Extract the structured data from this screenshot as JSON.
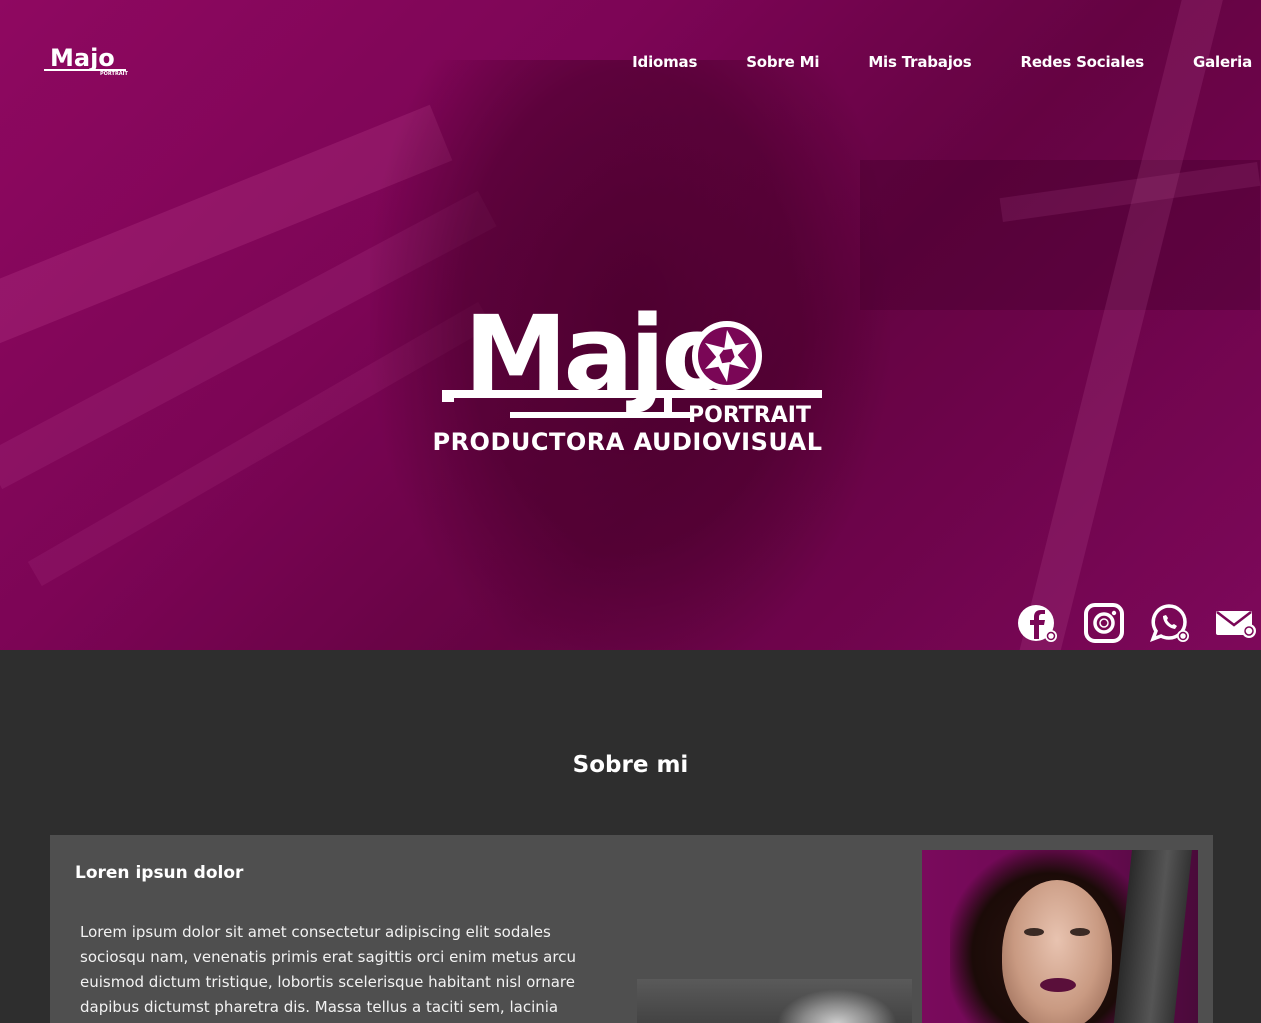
{
  "brand": {
    "logo_text": "Majo",
    "logo_sub": "PORTRAIT",
    "tagline": "PRODUCTORA AUDIOVISUAL",
    "accent_color": "#9c0a6c"
  },
  "nav": {
    "items": [
      {
        "label": "Idiomas"
      },
      {
        "label": "Sobre Mi"
      },
      {
        "label": "Mis Trabajos"
      },
      {
        "label": "Redes Sociales"
      },
      {
        "label": "Galeria"
      }
    ]
  },
  "socials": [
    {
      "icon": "facebook-icon"
    },
    {
      "icon": "instagram-icon"
    },
    {
      "icon": "whatsapp-icon"
    },
    {
      "icon": "email-icon"
    }
  ],
  "about": {
    "title": "Sobre mi",
    "heading": "Loren ipsun dolor",
    "body": "Lorem ipsum dolor sit amet consectetur adipiscing elit sodales sociosqu nam, venenatis primis erat sagittis orci enim metus arcu euismod dictum tristique, lobortis scelerisque habitant nisl ornare dapibus dictumst pharetra dis. Massa tellus a taciti sem, lacinia"
  }
}
